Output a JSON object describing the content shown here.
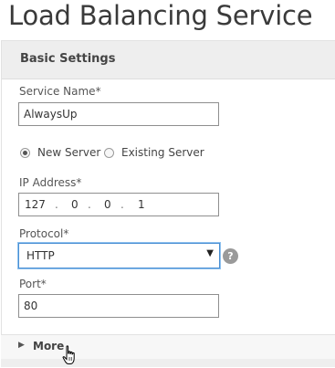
{
  "page": {
    "title": "Load Balancing Service"
  },
  "panel": {
    "title": "Basic Settings"
  },
  "form": {
    "service_name": {
      "label": "Service Name*",
      "value": "AlwaysUp"
    },
    "server_type": {
      "options": [
        {
          "label": "New Server",
          "selected": true
        },
        {
          "label": "Existing Server",
          "selected": false
        }
      ]
    },
    "ip_address": {
      "label": "IP Address*",
      "octets": [
        "127",
        "0",
        "0",
        "1"
      ],
      "separator": "."
    },
    "protocol": {
      "label": "Protocol*",
      "value": "HTTP",
      "arrow": "▼",
      "help": "?"
    },
    "port": {
      "label": "Port*",
      "value": "80"
    }
  },
  "more": {
    "label": "More",
    "caret": "▶"
  },
  "icons": {
    "help": "help-circle-icon",
    "dropdown": "chevron-down-icon",
    "expand": "caret-right-icon",
    "cursor": "hand-pointer-icon"
  },
  "colors": {
    "focus_border": "#4a8fd3",
    "header_bg": "#eeeeee",
    "help_icon_bg": "#9a9a9a"
  }
}
